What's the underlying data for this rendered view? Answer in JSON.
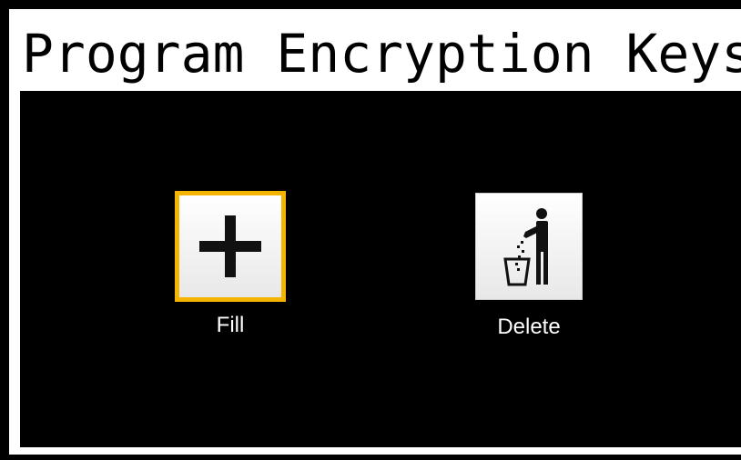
{
  "header": {
    "title": "Program Encryption Keys"
  },
  "actions": {
    "fill": {
      "label": "Fill",
      "icon": "plus-icon",
      "selected": true
    },
    "delete": {
      "label": "Delete",
      "icon": "trash-person-icon",
      "selected": false
    }
  },
  "colors": {
    "background": "#000000",
    "frame": "#ffffff",
    "selection_border": "#f5b400",
    "label_text": "#ffffff"
  }
}
